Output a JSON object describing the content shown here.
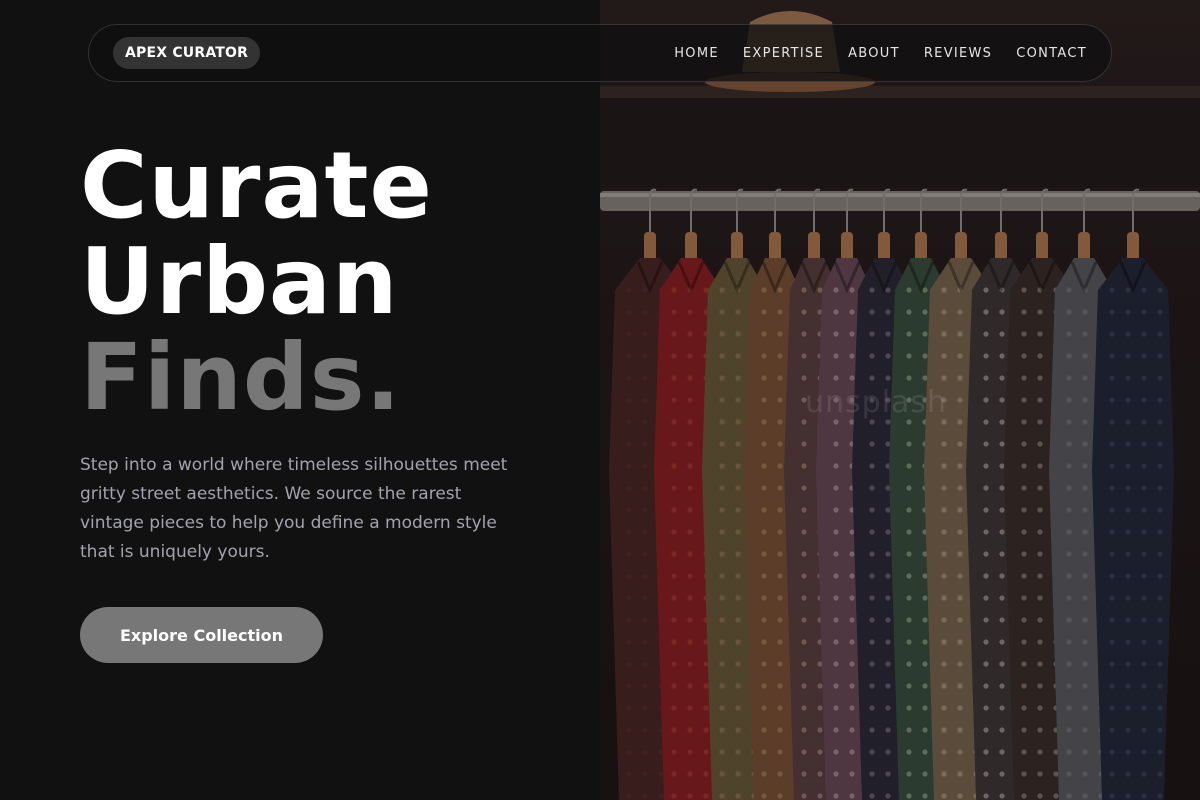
{
  "brand": {
    "logo_text": "APEX CURATOR"
  },
  "nav": {
    "links": [
      "HOME",
      "EXPERTISE",
      "ABOUT",
      "REVIEWS",
      "CONTACT"
    ]
  },
  "hero": {
    "headline_line1": "Curate",
    "headline_line2": "Urban",
    "headline_line3": "Finds.",
    "lead": "Step into a world where timeless silhouettes meet gritty street aesthetics. We source the rarest vintage pieces to help you define a modern style that is uniquely yours.",
    "cta_label": "Explore Collection"
  },
  "photo": {
    "subject": "vintage patterned shirts hanging on wooden hangers in a dark closet",
    "watermark": "unsplash"
  },
  "colors": {
    "background": "#111111",
    "text_primary": "#ffffff",
    "text_muted": "#777777",
    "text_body": "#a3a3ad",
    "button_bg": "#777777",
    "logo_bg": "#333333"
  }
}
